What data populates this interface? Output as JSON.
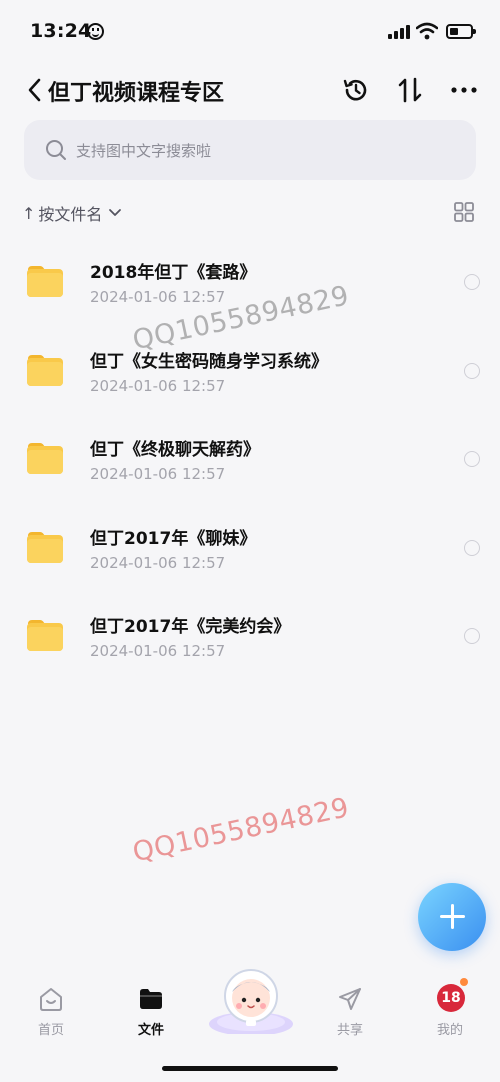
{
  "status": {
    "time": "13:24"
  },
  "nav": {
    "title": "但丁视频课程专区"
  },
  "search": {
    "placeholder": "支持图中文字搜索啦"
  },
  "sort": {
    "label": "按文件名",
    "arrow": "↑"
  },
  "folders": [
    {
      "name": "2018年但丁《套路》",
      "date": "2024-01-06 12:57"
    },
    {
      "name": "但丁《女生密码随身学习系统》",
      "date": "2024-01-06 12:57"
    },
    {
      "name": "但丁《终极聊天解药》",
      "date": "2024-01-06 12:57"
    },
    {
      "name": "但丁2017年《聊妹》",
      "date": "2024-01-06 12:57"
    },
    {
      "name": "但丁2017年《完美约会》",
      "date": "2024-01-06 12:57"
    }
  ],
  "watermarks": [
    "QQ1055894829",
    "QQ1055894829"
  ],
  "tabs": [
    {
      "label": "首页",
      "icon": "home-icon",
      "active": false
    },
    {
      "label": "文件",
      "icon": "folder-icon",
      "active": true
    },
    {
      "label": "共享",
      "icon": "send-icon",
      "active": false
    },
    {
      "label": "我的",
      "icon": "avatar",
      "avatar_text": "18",
      "active": false
    }
  ],
  "colors": {
    "accent": "#3a8ff0",
    "folder": "#f9c94a",
    "avatar": "#d8283b",
    "watermark_red": "#e66e6e"
  }
}
